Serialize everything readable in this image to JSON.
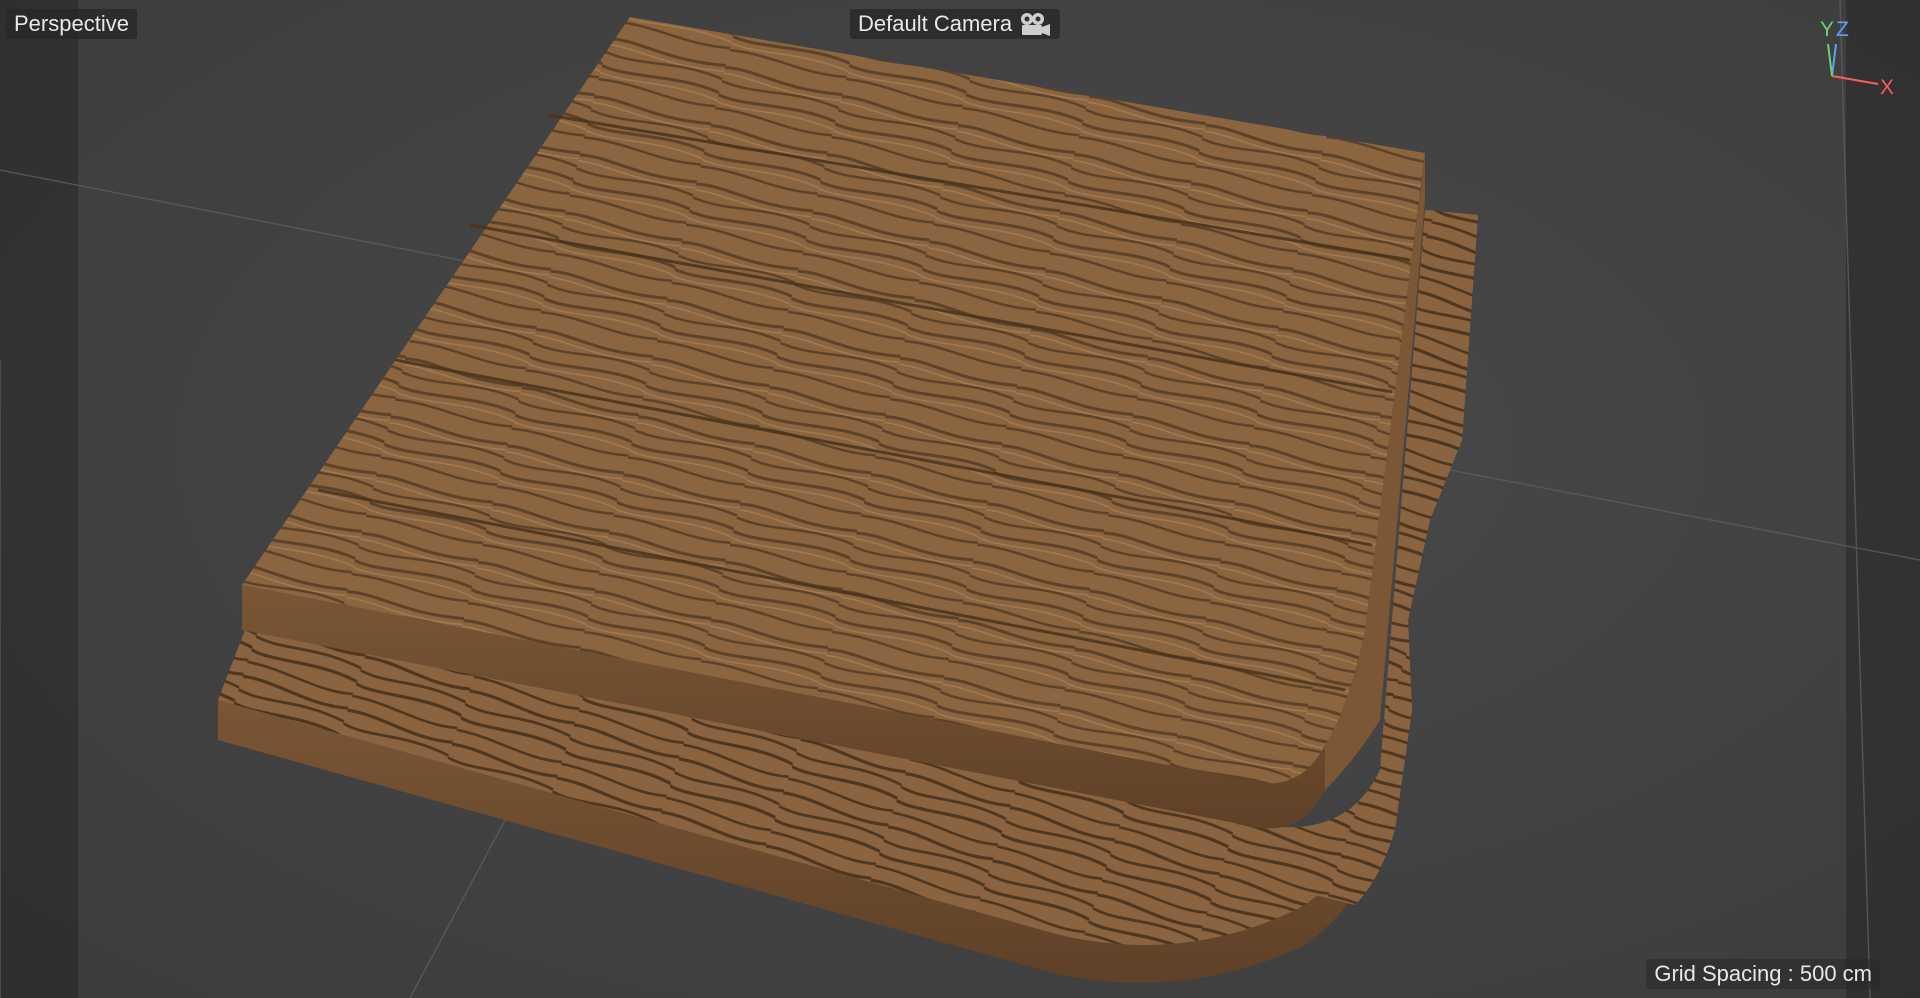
{
  "viewport": {
    "view_name": "Perspective",
    "camera_name": "Default Camera",
    "camera_icon": "camera-icon",
    "grid_spacing": "Grid Spacing : 500 cm",
    "background_color": "#444444"
  },
  "axis_gizmo": {
    "y_label": "Y",
    "z_label": "Z",
    "x_label": "X",
    "colors": {
      "x": "#ff5a5a",
      "y": "#6cd36c",
      "z": "#5aa0ff"
    }
  },
  "scene": {
    "object": "wood-plank-platform",
    "wood_color": "#8a6440",
    "wood_shadow_color": "#5b4027"
  }
}
